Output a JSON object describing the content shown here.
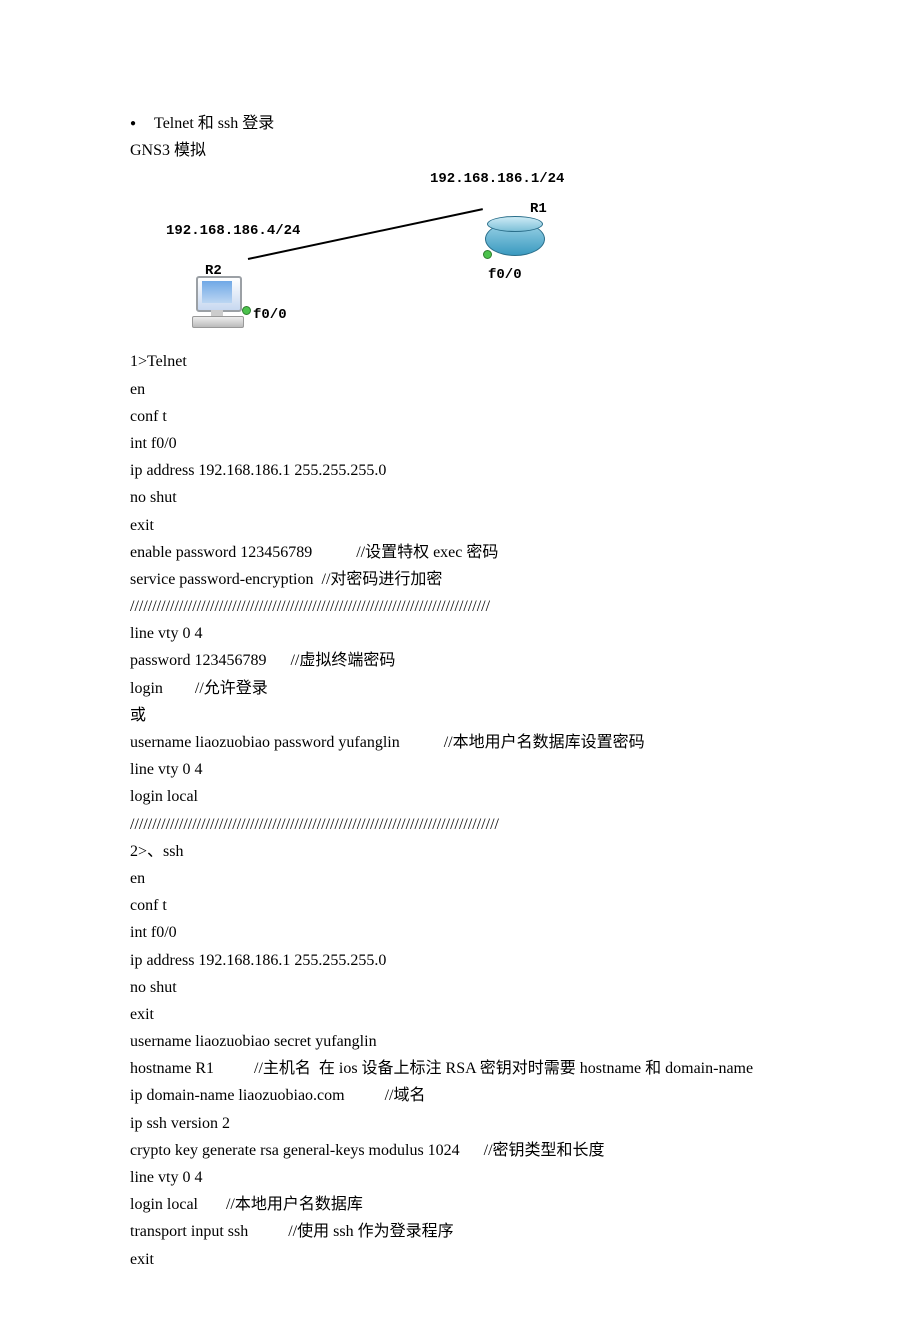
{
  "heading_bullet": "Telnet 和 ssh 登录",
  "gns3": "GNS3 模拟",
  "diagram": {
    "ip_r1": "192.168.186.1/24",
    "ip_r2": "192.168.186.4/24",
    "r1": "R1",
    "r2": "R2",
    "f00": "f0/0"
  },
  "lines": [
    "1>Telnet",
    "en",
    "conf t",
    "int f0/0",
    "ip address 192.168.186.1 255.255.255.0",
    "no shut",
    "exit",
    "enable password 123456789           //设置特权 exec 密码",
    "service password-encryption  //对密码进行加密",
    "/////////////////////////////////////////////////////////////////////////////////",
    "line vty 0 4",
    "password 123456789      //虚拟终端密码",
    "login        //允许登录",
    "或",
    "username liaozuobiao password yufanglin           //本地用户名数据库设置密码",
    "line vty 0 4",
    "login local",
    "///////////////////////////////////////////////////////////////////////////////////",
    "2>、ssh",
    "en",
    "conf t",
    "int f0/0",
    "ip address 192.168.186.1 255.255.255.0",
    "no shut",
    "exit",
    "username liaozuobiao secret yufanglin",
    "hostname R1          //主机名  在 ios 设备上标注 RSA 密钥对时需要 hostname 和 domain-name",
    "ip domain-name liaozuobiao.com          //域名",
    "ip ssh version 2",
    "crypto key generate rsa general-keys modulus 1024      //密钥类型和长度",
    "line vty 0 4",
    "login local       //本地用户名数据库",
    "transport input ssh          //使用 ssh 作为登录程序",
    "exit"
  ]
}
